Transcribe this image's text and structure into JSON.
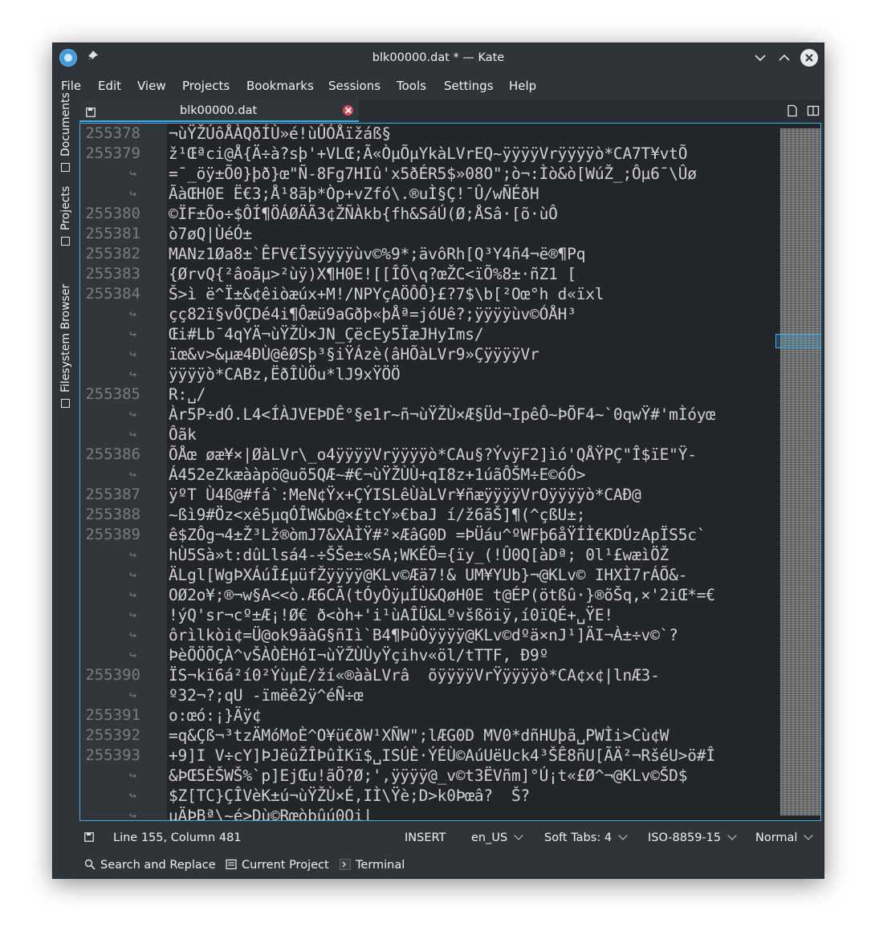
{
  "window": {
    "title": "blk00000.dat * — Kate",
    "icons": [
      "kate-app-icon",
      "pin-icon",
      "minimize-icon",
      "maximize-icon",
      "close-icon"
    ]
  },
  "menubar": {
    "items": [
      "File",
      "Edit",
      "View",
      "Projects",
      "Bookmarks",
      "Sessions",
      "Tools",
      "Settings",
      "Help"
    ]
  },
  "sidebar": {
    "tabs": [
      {
        "label": "Documents",
        "icon": "documents-icon"
      },
      {
        "label": "Projects",
        "icon": "projects-icon"
      },
      {
        "label": "Filesystem Browser",
        "icon": "folder-icon"
      }
    ]
  },
  "tabbar": {
    "active_tab": "blk00000.dat",
    "icons": [
      "save-icon",
      "tab-close-icon",
      "new-tab-icon",
      "split-view-icon"
    ]
  },
  "editor": {
    "gutter": [
      "255378",
      "255379",
      "",
      "",
      "255380",
      "255381",
      "255382",
      "255383",
      "255384",
      "",
      "",
      "",
      "",
      "255385",
      "",
      "",
      "255386",
      "",
      "255387",
      "255388",
      "255389",
      "",
      "",
      "",
      "",
      "",
      "",
      "255390",
      "",
      "255391",
      "255392",
      "255393",
      "",
      "",
      ""
    ],
    "lines": [
      "¬ùŸŽÚôÅÀQðÍÙ»é!ùÛÓÅïžáß§",
      "ž¹Œªci@Å{Ä÷à?sþ'+VLŒ;Ã«ÒµÕµYkàLVrEQ~ÿÿÿÿVrÿÿÿÿò*CA7T¥vtÕ",
      "=¯_öÿ±Õ0}þð}œ\"Ñ-8Fg7HIû'x5ðÉR5$»08O\";ò¬:Ìò&ò[WúŽ_;Ôµ6¯\\Ûø",
      "ÃàŒH0E Ë€3;Å¹8ãþ*Òp+vZfó\\.®uÌ§Ç!¯Û/wÑÉðH",
      "©ÏF±Õo÷$ÔÍ¶ÖÁØÄÃ3¢ŽÑÀkb{fh&SáÚ(Ø;ÅSâ·[õ·ùÔ",
      "ò7øQ|ÙéÓ±",
      "MANz1Øa8±`ÊFV€ÏSÿÿÿÿùv©%9*;ävôRh[Q³Y4ñ4¬ë®¶Pq",
      "{ØrvQ{²âoãµ>²ùÿ)X¶H0E![[ÎÕ\\q?œŽC<ïÕ%8±·ñZ1 [",
      "Š>ì ë^Ï±&¢êiòæúx+M!/NPYçAÖÔÔ}£?7$\\b[²Oœ°h d«ïxl",
      "çç82ï§vÕÇDé4i¶Ôæü9aGðþ«þÅª=jóUê?;ÿÿÿÿùv©ÓÅH³",
      "Œi#Lb¯4qYÄ¬ùŸŽÙ×JN_ÇëcEy5ÏæJHyIms/",
      "ïœ&v>&µæ4ÐÙ@êØSþ³§iŸÁzè(âHÕàLVr9»ÇÿÿÿÿVr",
      "ÿÿÿÿò*CABz,ËðÎÙÖu*lJ9xŸÖÖ",
      "R:␣/",
      "Àr5P÷dÓ.L4<ÍÀJVEÞDÊ°§e1r~ñ¬ùŸŽÙ×Æ§Üd¬IpêÔ~ÞÕF4~`0qwŸ#'mÌóyœ",
      "Ôãk",
      "ÕÅœ øæ¥×|ØàLVr\\_o4ÿÿÿÿVrÿÿÿÿò*CAu§?ÝvÿF2]ìó'QÅŸPÇ\"Î$ïE\"Ÿ-",
      "Á452eZkæààpö@uõ5QÆ~#€¬ùŸŽÙÙ+qI8z+1úãÔŠM÷E©óÓ>",
      "ÿºT Ù4ß@#fá`:MeN¢Ÿx+ÇÝISLêÙàLVr¥ñæÿÿÿÿVrOÿÿÿÿò*CAÐ@",
      "~ßì9#Öz<xê5µqÓÎW&b@×£tcY»€baJ í/ž6ãŠ]¶(^çßU±;",
      "ê$ZÔg¬4±Ž³Lž®òmJ7&XÀÌŸ#²×ÆâG0D =ÞÜáu^ºWFþ6åŸÍÌ€KDÚzApÏS5c`",
      "hÙ5Sà»t:dûLlsá4-÷ŠŠe±«SA;WKÉÕ={ïy_(!Û0Q[àDª; 0l¹£wæìÖŽ",
      "ÄLgl[WgÞXÁúÎ£µüfŽÿÿÿÿ@KLv©Æä7!& UM¥YUb}¬@KLv© IHXÌ7rÁÕ&-",
      "OØ2o¥;®¬w§A<<ò.Æ6CÃ(tÓyÒÿµÍÙ&QøH0E t@ÉP(ötßû·}®õŠq,×'2iŒ*=€",
      "!ýQ'sr¬cº±Æ¡!Ø€ ð<òh+'i¹ùAÎÜ&Lºvšßöiÿ,í0ïQÉ+␣ŸE!",
      "ôrìlkòi¢=Ü@ok9ãàG§ñIì`B4¶ÞûÒÿÿÿÿ@KLv©dºä×nJ¹]ÄI¬À±÷v©`?",
      "ÞèÕÖÕÇÀ^vŠÀÒÈHóI¬ùŸŽÙÙyŸçihv«öl/tTTF, Ð9º",
      "ÏS¬kï6á²í0²ÝùµÊ/ží«®ààLVrâ  õÿÿÿÿVrŸÿÿÿÿò*CA¢x¢|lnÆ3-",
      "º32¬?;qU -ïmëê2ÿ^éÑ÷œ",
      "o:œó:¡}Äÿ¢",
      "=q&Çß¬³tzÄMóMoÈ^O¥ü€ðW¹XÑW\";lÆG0D MV0*dñHUþã␣PWÌi>Cù¢W",
      "+9]I V÷cY]ÞJëûŽÎÞûÌKï$␣ISÚÈ·ÝÉÙ©AúUëUck4³ŠÊ8ñU[ÃÄ²¬RšéU>ö#Î",
      "&ÞŒ5ÈŠWŠ%`p]EjŒu!ãÖ?Ø;',ÿÿÿÿ@_v©t3ËVñm]°Ú¡t«£Ø^¬@KLv©ŠD$",
      "$Z[TC}ÇÎVèK±ú¬ùŸŽÙ×É,IÌ\\Ÿè;D>k0Þœâ?  Š?",
      "µÄÞBª\\~é>Dù©Rœòbûú0Oi|"
    ]
  },
  "statusbar": {
    "position": "Line 155, Column 481",
    "mode": "INSERT",
    "dictionary": "en_US",
    "indent": "Soft Tabs: 4",
    "encoding": "ISO-8859-15",
    "input_mode": "Normal"
  },
  "toolviews": {
    "items": [
      {
        "label": "Search and Replace",
        "icon": "search-icon"
      },
      {
        "label": "Current Project",
        "icon": "project-icon"
      },
      {
        "label": "Terminal",
        "icon": "terminal-icon"
      }
    ]
  },
  "colors": {
    "accent": "#3daee9",
    "window_bg": "#2f3439",
    "editor_bg": "#232629",
    "gutter_bg": "#31363b",
    "close_tab": "#da4453"
  }
}
